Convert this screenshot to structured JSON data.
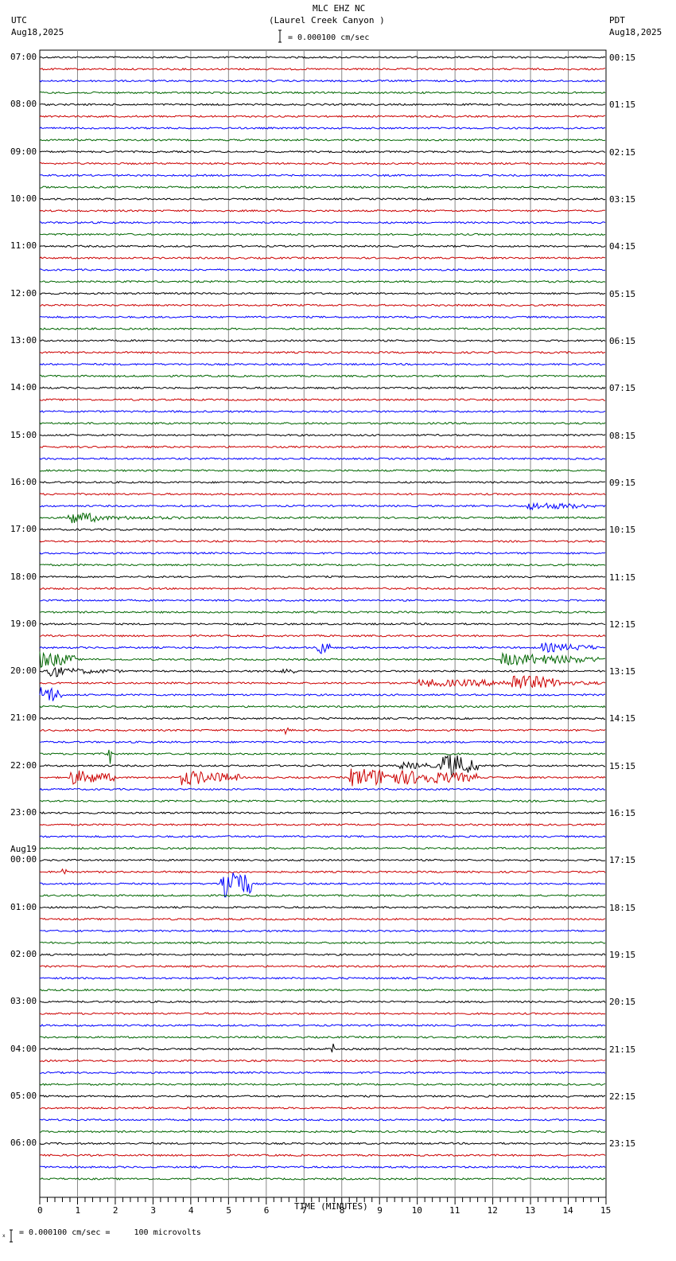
{
  "header": {
    "station": "MLC EHZ NC",
    "location": "(Laurel Creek Canyon )",
    "left_tz": "UTC",
    "left_date": "Aug18,2025",
    "right_tz": "PDT",
    "right_date": "Aug18,2025",
    "scale": "= 0.000100 cm/sec"
  },
  "footer": {
    "scale": "= 0.000100 cm/sec =     100 microvolts",
    "prefix": "x"
  },
  "chart_data": {
    "type": "line",
    "title": "MLC EHZ NC (Laurel Creek Canyon )",
    "xlabel": "TIME (MINUTES)",
    "xlim": [
      0,
      15
    ],
    "xticks": [
      "0",
      "1",
      "2",
      "3",
      "4",
      "5",
      "6",
      "7",
      "8",
      "9",
      "10",
      "11",
      "12",
      "13",
      "14",
      "15"
    ],
    "grid": true,
    "traces_per_hour": 4,
    "trace_colors": [
      "#000000",
      "#cc0000",
      "#0000ff",
      "#006600"
    ],
    "left_labels": [
      "07:00",
      "08:00",
      "09:00",
      "10:00",
      "11:00",
      "12:00",
      "13:00",
      "14:00",
      "15:00",
      "16:00",
      "17:00",
      "18:00",
      "19:00",
      "20:00",
      "21:00",
      "22:00",
      "23:00",
      "00:00",
      "01:00",
      "02:00",
      "03:00",
      "04:00",
      "05:00",
      "06:00"
    ],
    "date_change_label": "Aug19",
    "right_labels": [
      "00:15",
      "01:15",
      "02:15",
      "03:15",
      "04:15",
      "05:15",
      "06:15",
      "07:15",
      "08:15",
      "09:15",
      "10:15",
      "11:15",
      "12:15",
      "13:15",
      "14:15",
      "15:15",
      "16:15",
      "17:15",
      "18:15",
      "19:15",
      "20:15",
      "21:15",
      "22:15",
      "23:15"
    ],
    "events": [
      {
        "trace": 38,
        "start": 12.9,
        "end": 14.8,
        "amp": 5
      },
      {
        "trace": 39,
        "start": 0.7,
        "end": 1.7,
        "amp": 9
      },
      {
        "trace": 39,
        "start": 1.7,
        "end": 4.8,
        "amp": 2.5
      },
      {
        "trace": 50,
        "start": 7.3,
        "end": 7.7,
        "amp": 12
      },
      {
        "trace": 50,
        "start": 13.3,
        "end": 14.8,
        "amp": 6
      },
      {
        "trace": 51,
        "start": 0,
        "end": 1,
        "amp": 11
      },
      {
        "trace": 51,
        "start": 12.2,
        "end": 14.8,
        "amp": 8
      },
      {
        "trace": 52,
        "start": 0.1,
        "end": 0.6,
        "amp": 12
      },
      {
        "trace": 52,
        "start": 0.6,
        "end": 2.2,
        "amp": 4
      },
      {
        "trace": 52,
        "start": 6.4,
        "end": 6.8,
        "amp": 6
      },
      {
        "trace": 53,
        "start": 10,
        "end": 14.8,
        "amp": 5
      },
      {
        "trace": 53,
        "start": 12.5,
        "end": 13.8,
        "amp": 12
      },
      {
        "trace": 54,
        "start": 0,
        "end": 0.6,
        "amp": 14
      },
      {
        "trace": 57,
        "start": 6.5,
        "end": 6.6,
        "amp": 6
      },
      {
        "trace": 59,
        "start": 1.8,
        "end": 1.9,
        "amp": 16
      },
      {
        "trace": 60,
        "start": 10.6,
        "end": 11.6,
        "amp": 18
      },
      {
        "trace": 60,
        "start": 9.5,
        "end": 10.6,
        "amp": 5
      },
      {
        "trace": 61,
        "start": 0.8,
        "end": 2.0,
        "amp": 10
      },
      {
        "trace": 61,
        "start": 3.7,
        "end": 5.3,
        "amp": 10
      },
      {
        "trace": 61,
        "start": 8.2,
        "end": 11.6,
        "amp": 12
      },
      {
        "trace": 70,
        "start": 4.8,
        "end": 5.6,
        "amp": 28
      },
      {
        "trace": 69,
        "start": 0.6,
        "end": 0.7,
        "amp": 6
      },
      {
        "trace": 84,
        "start": 7.7,
        "end": 7.8,
        "amp": 7
      }
    ]
  }
}
